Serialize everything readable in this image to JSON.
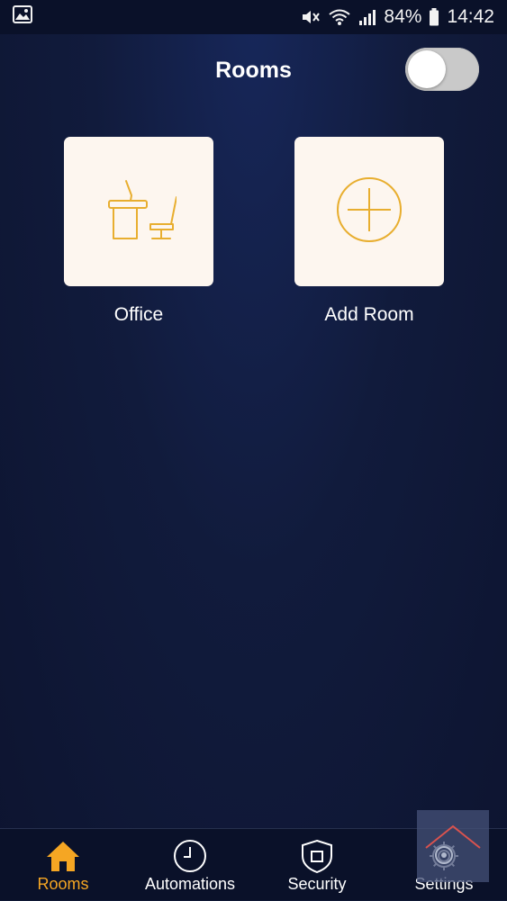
{
  "status_bar": {
    "battery_percent": "84%",
    "time": "14:42",
    "icons": [
      "image-icon",
      "mute-icon",
      "wifi-icon",
      "signal-icon",
      "battery-icon"
    ]
  },
  "header": {
    "title": "Rooms",
    "toggle_on": false
  },
  "rooms": [
    {
      "label": "Office",
      "icon": "office-desk-icon"
    },
    {
      "label": "Add Room",
      "icon": "add-circle-icon"
    }
  ],
  "bottom_nav": {
    "items": [
      {
        "label": "Rooms",
        "icon": "home-icon",
        "active": true
      },
      {
        "label": "Automations",
        "icon": "clock-icon",
        "active": false
      },
      {
        "label": "Security",
        "icon": "shield-icon",
        "active": false
      },
      {
        "label": "Settings",
        "icon": "gear-icon",
        "active": false
      }
    ]
  },
  "colors": {
    "accent": "#f5a623",
    "icon_line": "#e8ae2f",
    "card_bg": "#fdf6ef",
    "background": "#111b3c"
  }
}
